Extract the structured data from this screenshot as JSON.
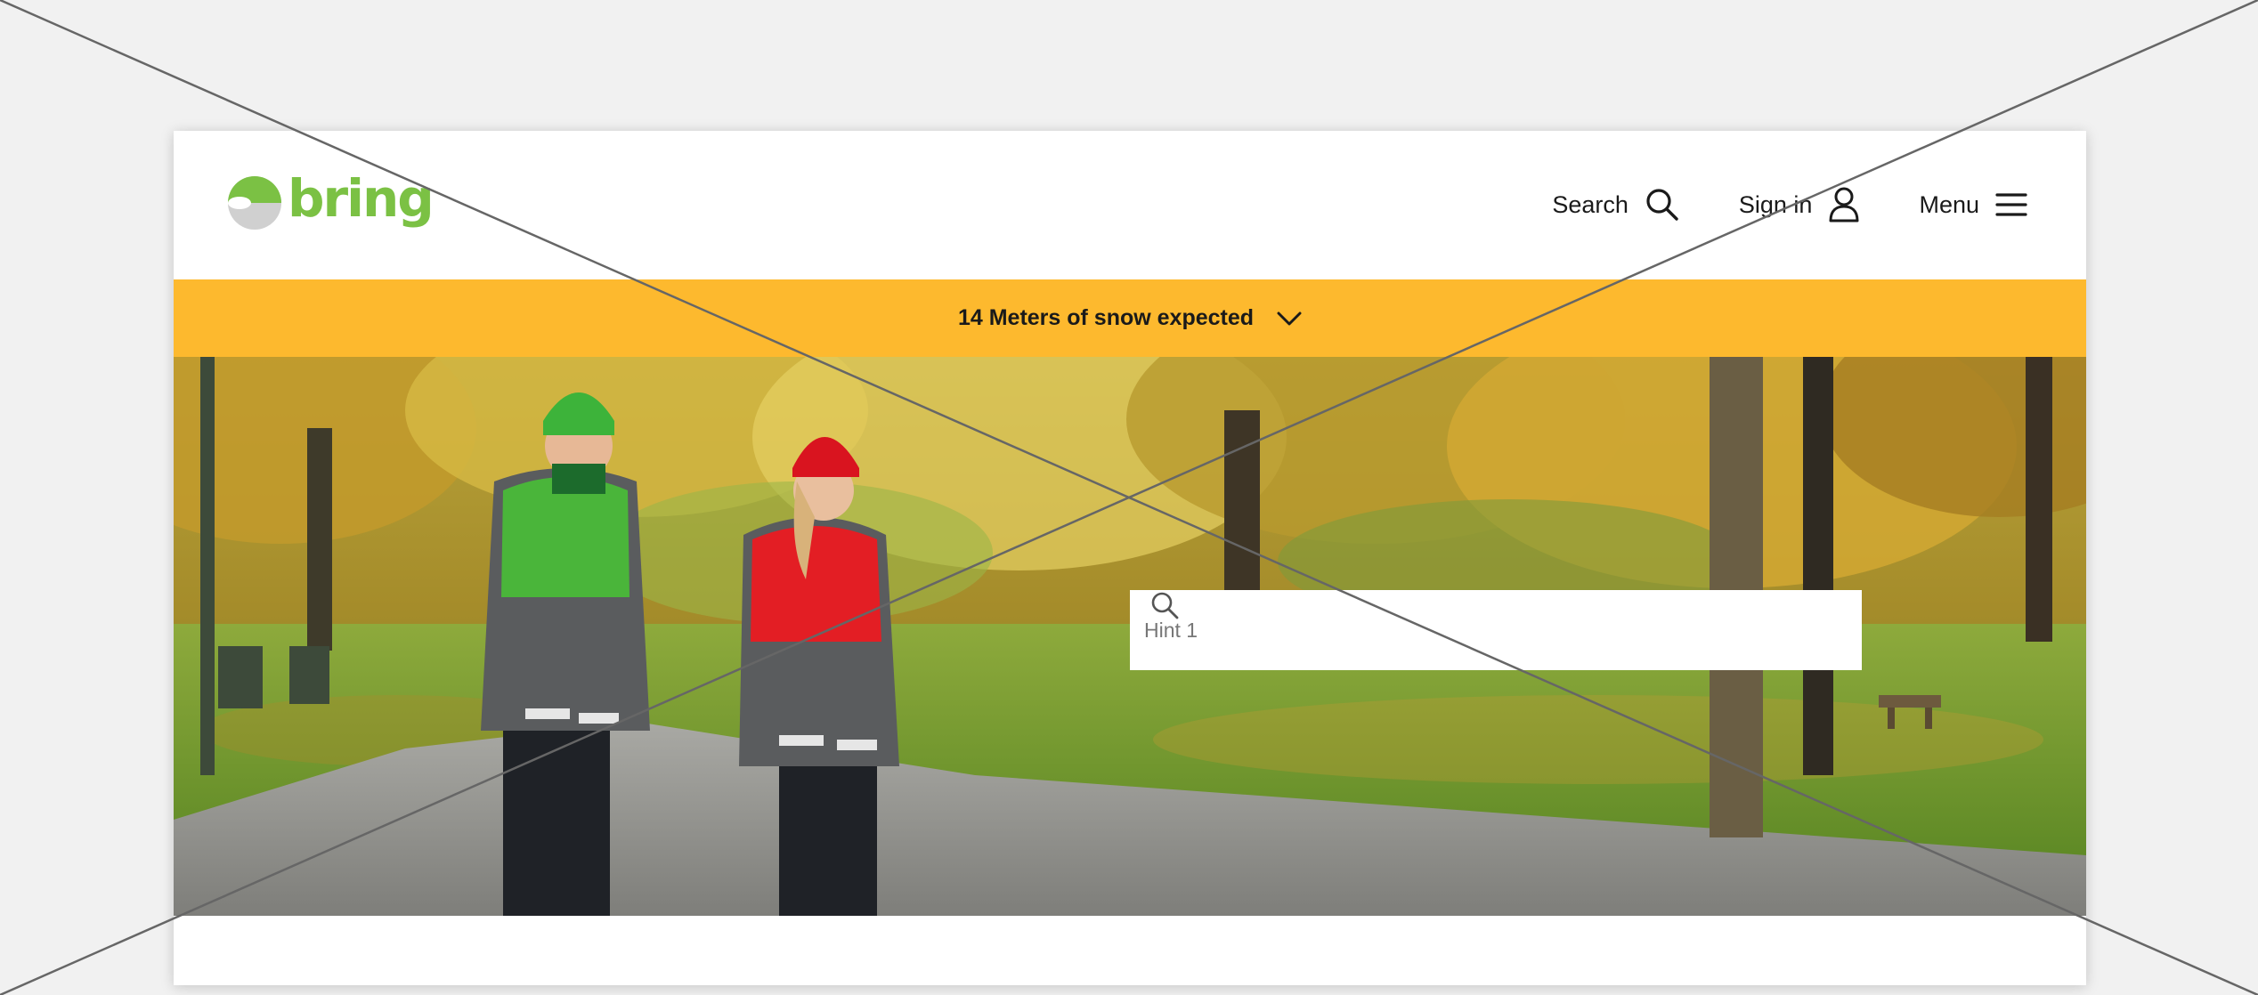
{
  "brand": {
    "logo_text": "bring",
    "primary_color": "#7bc144",
    "logo_secondary_color": "#d0d0d0"
  },
  "nav": {
    "search_label": "Search",
    "signin_label": "Sign in",
    "menu_label": "Menu"
  },
  "alert_banner": {
    "text": "14 Meters of snow expected",
    "background": "#fdb92e"
  },
  "hero": {
    "image_alt": "Two Bring employees in green and red work jackets walking in an autumn park",
    "search_placeholder": "Hint 1"
  },
  "icons": {
    "search": "search-icon",
    "signin": "user-icon",
    "menu": "hamburger-icon",
    "chevron": "chevron-down-icon"
  }
}
